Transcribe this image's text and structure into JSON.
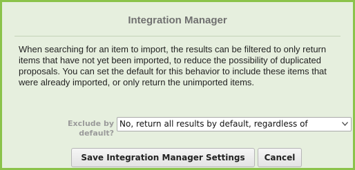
{
  "dialog": {
    "title": "Integration Manager",
    "description": "When searching for an item to import, the results can be filtered to only return items that have not yet been imported, to reduce the possibility of duplicated proposals. You can set the default for this behavior to include these items that were already imported, or only return the unimported items.",
    "exclude_label": "Exclude by default?",
    "exclude_select": {
      "selected": "No, return all results by default, regardless of"
    },
    "save_label": "Save Integration Manager Settings",
    "cancel_label": "Cancel"
  },
  "colors": {
    "accent_border": "#8bc34a",
    "panel_background": "#e6efde"
  },
  "icons": {
    "select_arrow": "chevron-down-icon"
  }
}
